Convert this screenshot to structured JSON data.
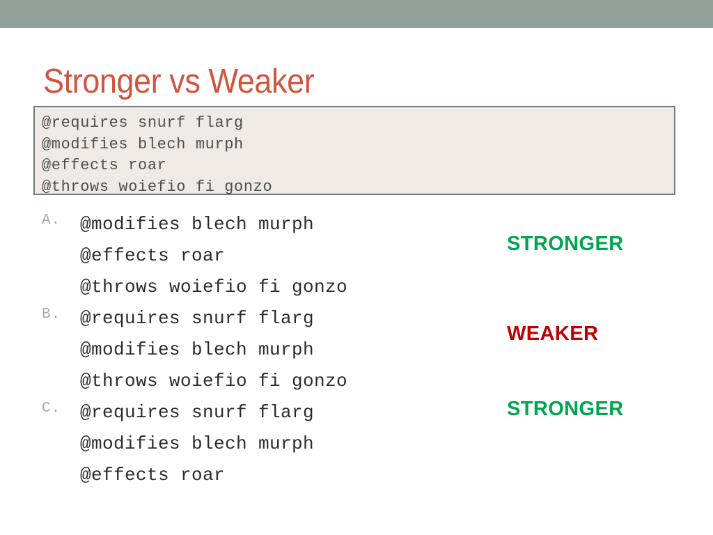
{
  "theme": {
    "bar_color": "#93a09a",
    "title_color": "#d0553f",
    "box_background": "#efeae5",
    "box_border": "#6e7a75",
    "stronger_color": "#00a550",
    "weaker_color": "#c00000",
    "code_color": "#2b2b2b",
    "letter_color": "#a9a9a9"
  },
  "slide": {
    "title": "Stronger vs Weaker"
  },
  "spec_box": {
    "lines": [
      "@requires snurf flarg",
      "@modifies blech murph",
      "@effects roar",
      "@throws woiefio fi gonzo"
    ]
  },
  "answers": [
    {
      "letter": "A.",
      "lines": [
        "@modifies blech murph",
        "@effects roar",
        "@throws woiefio fi gonzo"
      ],
      "verdict": "STRONGER",
      "verdict_kind": "stronger"
    },
    {
      "letter": "B.",
      "lines": [
        "@requires snurf flarg",
        "@modifies blech murph",
        "@throws woiefio fi gonzo"
      ],
      "verdict": "WEAKER",
      "verdict_kind": "weaker"
    },
    {
      "letter": "C.",
      "lines": [
        "@requires snurf flarg",
        "@modifies blech murph",
        "@effects roar"
      ],
      "verdict": "STRONGER",
      "verdict_kind": "stronger"
    }
  ]
}
